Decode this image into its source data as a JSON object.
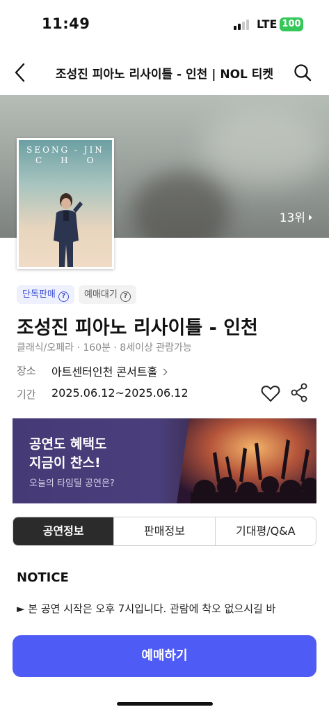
{
  "status_bar": {
    "time": "11:49",
    "network": "LTE",
    "battery": "100",
    "battery_color": "#34c759"
  },
  "header": {
    "title": "조성진 피아노 리사이틀 - 인천 | NOL 티켓",
    "back_icon": "chevron-left-icon",
    "search_icon": "search-icon"
  },
  "hero": {
    "rank": "13위",
    "poster": {
      "name_line1": "SEONG - JIN",
      "name_line2": "CHO"
    }
  },
  "badges": {
    "exclusive": "단독판매",
    "waiting": "예매대기"
  },
  "performance": {
    "title": "조성진 피아노 리사이틀 - 인천",
    "meta": "클래식/오페라 · 160분 · 8세이상 관람가능",
    "venue_label": "장소",
    "venue": "아트센터인천 콘서트홀",
    "period_label": "기간",
    "period": "2025.06.12~2025.06.12"
  },
  "promo": {
    "line1": "공연도 혜택도",
    "line2": "지금이 찬스!",
    "sub": "오늘의 타임딜 공연은?"
  },
  "tabs": [
    {
      "label": "공연정보",
      "active": true
    },
    {
      "label": "판매정보",
      "active": false
    },
    {
      "label": "기대평/Q&A",
      "active": false
    }
  ],
  "notice": {
    "title": "NOTICE",
    "text": "► 본 공연 시작은 오후 7시입니다. 관람에 착오 없으시길 바"
  },
  "cta": {
    "label": "예매하기",
    "color": "#4f5bf5"
  }
}
